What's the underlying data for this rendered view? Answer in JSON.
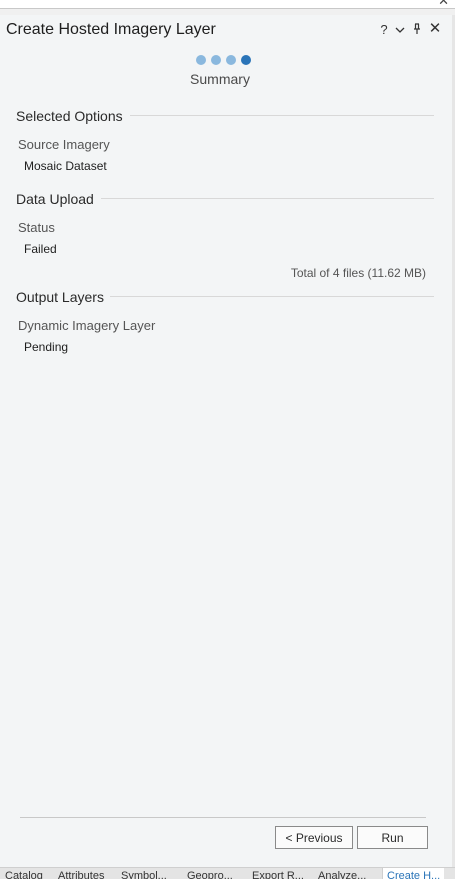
{
  "window": {
    "title": "Create Hosted Imagery Layer",
    "help_glyph": "?",
    "menu_glyph": "⌄",
    "pin_glyph": "🖈",
    "close_glyph": "✕",
    "outer_close_glyph": "✕"
  },
  "wizard": {
    "step_count": 4,
    "current_step": 4,
    "step_label": "Summary"
  },
  "selected_options": {
    "heading": "Selected Options",
    "source_label": "Source Imagery",
    "source_value": "Mosaic Dataset"
  },
  "data_upload": {
    "heading": "Data Upload",
    "status_label": "Status",
    "status_value": "Failed",
    "total_text": "Total of 4 files (11.62 MB)"
  },
  "output_layers": {
    "heading": "Output Layers",
    "layer_label": "Dynamic Imagery Layer",
    "layer_value": "Pending"
  },
  "buttons": {
    "previous": "< Previous",
    "run": "Run"
  },
  "tabs": [
    {
      "label": "Catalog"
    },
    {
      "label": "Attributes"
    },
    {
      "label": "Symbol..."
    },
    {
      "label": "Geopro..."
    },
    {
      "label": "Export R..."
    },
    {
      "label": "Analyze..."
    },
    {
      "label": "Create H..."
    }
  ],
  "colors": {
    "accent": "#2a74b8",
    "dot_inactive": "#8ab8de"
  }
}
